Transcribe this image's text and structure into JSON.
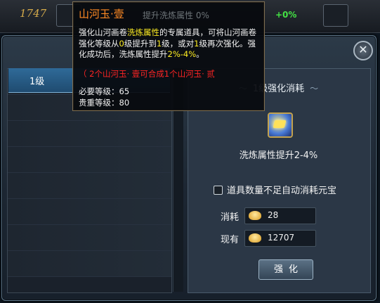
{
  "background": {
    "left_number": "1747",
    "right_percent": "+0%"
  },
  "dialog": {
    "close_glyph": "✕",
    "level_tab_label": "1级",
    "right_title": "1级强化消耗",
    "item_desc": "洗炼属性提升2-4%",
    "auto_consume_label": "道具数量不足自动消耗元宝",
    "cost_label": "消耗",
    "cost_value": "28",
    "have_label": "现有",
    "have_value": "12707",
    "action_button": "强化"
  },
  "tooltip": {
    "title": "山河玉·壹",
    "subtitle": "提升洗炼属性 0%",
    "desc_p1": "强化山河画卷",
    "desc_hl1": "洗炼属性",
    "desc_p2": "的专属道具，可将山河画卷强化等级从",
    "desc_hl2": "0",
    "desc_p3": "级提升到",
    "desc_hl3": "1",
    "desc_p4": "级，或对",
    "desc_hl4": "1",
    "desc_p5": "级再次强化。强化成功后，洗炼属性提升",
    "desc_hl5": "2%-4%",
    "desc_p6": "。",
    "red_note": "（ 2个山河玉· 壹可合成1个山河玉· 贰",
    "req_level": "必要等级：65",
    "rare_level": "贵重等级：80"
  },
  "colors": {
    "tooltip_title": "#ff8a24",
    "highlight_yellow": "#ffee22",
    "note_red": "#ff2424",
    "positive_green": "#44e344"
  },
  "icons": [
    "close-icon",
    "item-icon",
    "ingot-icon",
    "checkbox-icon"
  ]
}
